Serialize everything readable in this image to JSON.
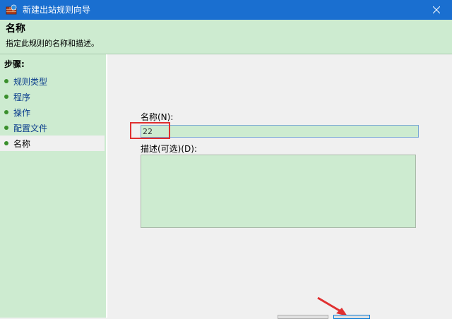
{
  "window": {
    "title": "新建出站规则向导",
    "close_icon": "close-icon",
    "app_icon": "firewall-wizard-icon"
  },
  "header": {
    "title": "名称",
    "description": "指定此规则的名称和描述。"
  },
  "sidebar": {
    "steps_label": "步骤:",
    "items": [
      {
        "label": "规则类型",
        "active": false
      },
      {
        "label": "程序",
        "active": false
      },
      {
        "label": "操作",
        "active": false
      },
      {
        "label": "配置文件",
        "active": false
      },
      {
        "label": "名称",
        "active": true
      }
    ]
  },
  "form": {
    "name_label": "名称(N):",
    "name_value": "22",
    "description_label": "描述(可选)(D):",
    "description_value": ""
  },
  "colors": {
    "titlebar": "#1a6fd0",
    "panel_green": "#cdebd0",
    "highlight_red": "#e03030"
  }
}
